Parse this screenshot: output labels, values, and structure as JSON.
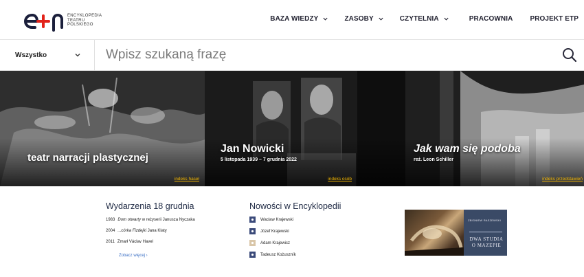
{
  "header": {
    "logo_text_lines": [
      "ENCYKLOPEDIA",
      "TEATRU",
      "POLSKIEGO"
    ],
    "nav": [
      {
        "label": "BAZA WIEDZY",
        "has_dropdown": true
      },
      {
        "label": "ZASOBY",
        "has_dropdown": true
      },
      {
        "label": "CZYTELNIA",
        "has_dropdown": true
      },
      {
        "label": "PRACOWNIA",
        "has_dropdown": false
      },
      {
        "label": "PROJEKT ETP",
        "has_dropdown": false
      }
    ]
  },
  "search": {
    "filter_label": "Wszystko",
    "placeholder": "Wpisz szukaną frazę",
    "icon": "search-icon"
  },
  "hero": [
    {
      "title": "teatr narracji plastycznej",
      "subtitle": "",
      "link": "indeks haseł"
    },
    {
      "title": "Jan Nowicki",
      "subtitle": "5 listopada 1939 – 7 grudnia 2022",
      "link": "indeks osób"
    },
    {
      "title": "Jak wam się podoba",
      "subtitle": "reż. Leon Schiller",
      "link": "indeks przedstawień"
    }
  ],
  "events": {
    "title": "Wydarzenia 18 grudnia",
    "items": [
      {
        "year": "1983",
        "italic": "Dom otwarty",
        "rest": " w reżyserii Janusza Nyczaka"
      },
      {
        "year": "2004",
        "italic": "...córka Fizdejki",
        "rest": " Jana Klaty"
      },
      {
        "year": "2011",
        "italic": "",
        "rest": "Zmarł Václav Havel"
      }
    ],
    "see_more": "Zobacz więcej ›"
  },
  "news": {
    "title": "Nowości w Encyklopedii",
    "items": [
      {
        "label": "Wacław Krajewski",
        "icon_color": "#3b4a7a"
      },
      {
        "label": "Józef Krajewski",
        "icon_color": "#3b4a7a"
      },
      {
        "label": "Adam Krajewicz",
        "icon_color": "#d9c6a8"
      },
      {
        "label": "Tadeusz Kożuszník",
        "icon_color": "#3b4a7a"
      }
    ]
  },
  "book": {
    "author": "ZBIGNIEW RASZEWSKI",
    "title_lines": [
      "DWA STUDIA",
      "O MAZEPIE"
    ]
  },
  "colors": {
    "nav_text": "#1f1f2e",
    "accent_link": "#f5b800",
    "see_more": "#3a6fc4",
    "book_cover": "#3a4a66"
  }
}
